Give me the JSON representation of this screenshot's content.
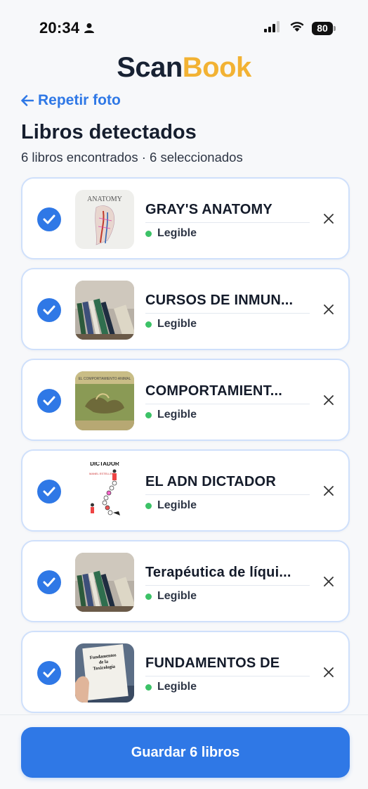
{
  "status_bar": {
    "time": "20:34",
    "battery": "80"
  },
  "logo": {
    "part1": "Scan",
    "part2": "Book"
  },
  "back_link": {
    "arrow": "←",
    "label": "Repetir foto"
  },
  "header": {
    "title": "Libros detectados",
    "subtitle": "6 libros encontrados · 6 seleccionados"
  },
  "colors": {
    "accent": "#2f78e6",
    "brand_dark": "#182233",
    "brand_yellow": "#f2b233",
    "status_green": "#3cc267",
    "card_border": "#cfe0fb"
  },
  "books": [
    {
      "title": "GRAY'S ANATOMY",
      "status": "Legible",
      "selected": true,
      "thumbnail": "anatomy-cover"
    },
    {
      "title": "CURSOS DE INMUN...",
      "status": "Legible",
      "selected": true,
      "thumbnail": "bookshelf-photo"
    },
    {
      "title": "COMPORTAMIENT...",
      "status": "Legible",
      "selected": true,
      "thumbnail": "green-cover"
    },
    {
      "title": "EL ADN DICTADOR",
      "status": "Legible",
      "selected": true,
      "thumbnail": "dna-cover"
    },
    {
      "title": "Terapéutica de líqui...",
      "status": "Legible",
      "selected": true,
      "thumbnail": "bookshelf-photo"
    },
    {
      "title": "FUNDAMENTOS DE",
      "status": "Legible",
      "selected": true,
      "thumbnail": "hand-holding-book"
    }
  ],
  "save_button": {
    "label": "Guardar 6 libros"
  }
}
